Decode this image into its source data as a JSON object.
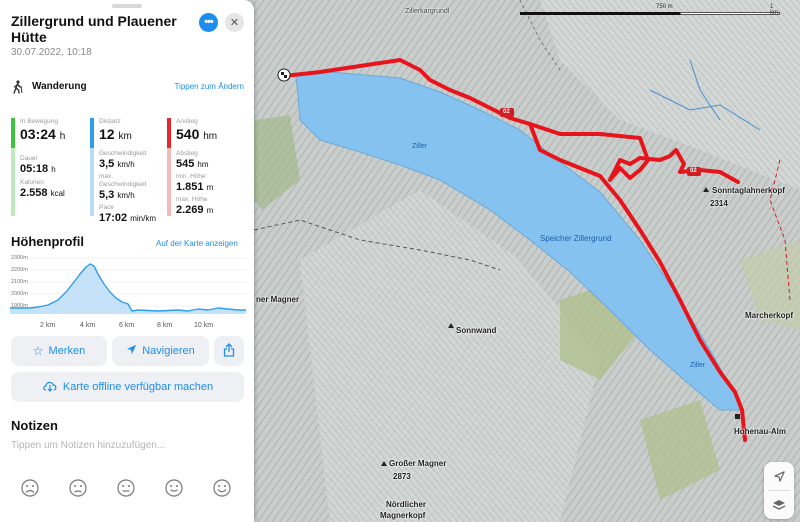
{
  "panel": {
    "title": "Zillergrund und Plauener Hütte",
    "date": "30.07.2022, 10:18",
    "more_icon": "ellipsis-icon",
    "close_icon": "close-icon",
    "activity": {
      "icon": "hiker-icon",
      "label": "Wanderung",
      "change_link": "Tippen zum Ändern"
    },
    "stats": [
      {
        "color_top": "#3cc43c",
        "color_bottom": "#bfe9bd",
        "items": [
          {
            "label": "In Bewegung",
            "value": "03:24",
            "unit": "h"
          },
          {
            "label": "Dauer",
            "value": "05:18",
            "unit": "h"
          },
          {
            "label": "Kalorien",
            "value": "2.558",
            "unit": "kcal"
          }
        ]
      },
      {
        "color_top": "#2f9ef0",
        "color_bottom": "#b9dcf8",
        "items": [
          {
            "label": "Distanz",
            "value": "12",
            "unit": "km"
          },
          {
            "label": "Geschwindigkeit",
            "value": "3,5",
            "unit": "km/h"
          },
          {
            "label": "max. Geschwindigkeit",
            "value": "5,3",
            "unit": "km/h"
          },
          {
            "label": "Pace",
            "value": "17:02",
            "unit": "min/km"
          }
        ]
      },
      {
        "color_top": "#e9262a",
        "color_bottom": "#f4b9b9",
        "items": [
          {
            "label": "Anstieg",
            "value": "540",
            "unit": "hm"
          },
          {
            "label": "Abstieg",
            "value": "545",
            "unit": "hm"
          },
          {
            "label": "min. Höhe",
            "value": "1.851",
            "unit": "m"
          },
          {
            "label": "max. Höhe",
            "value": "2.269",
            "unit": "m"
          }
        ]
      }
    ],
    "profile": {
      "title": "Höhenprofil",
      "map_link": "Auf der Karte anzeigen",
      "y_ticks": [
        "2300m",
        "2200m",
        "2100m",
        "2000m",
        "1900m"
      ],
      "x_ticks": [
        "2 km",
        "4 km",
        "6 km",
        "8 km",
        "10 km"
      ],
      "line_color": "#2f9ef0"
    },
    "buttons": {
      "bookmark": {
        "label": "Merken",
        "icon": "star-icon"
      },
      "navigate": {
        "label": "Navigieren",
        "icon": "navigation-arrow-icon"
      },
      "share": {
        "icon": "share-icon"
      },
      "offline": {
        "label": "Karte offline verfügbar machen",
        "icon": "cloud-download-icon"
      }
    },
    "notes": {
      "title": "Notizen",
      "placeholder": "Tippen um Notizen hinzuzufügen..."
    },
    "ratings": [
      "very-sad-face-icon",
      "sad-face-icon",
      "neutral-face-icon",
      "happy-face-icon",
      "very-happy-face-icon"
    ]
  },
  "map": {
    "labels": {
      "zillerkar": "Zillerkargrundl",
      "lake": "Speicher Zillergrund",
      "ziller1": "Ziller",
      "ziller2": "Ziller",
      "sonnwand": "Sonnwand",
      "grosser_magner": "Großer Magner",
      "grosser_magner_alt": "2873",
      "nordlicher": "Nördlicher",
      "magnerkopf": "Magnerkopf",
      "magner_left": "ner Magner",
      "sonntag": "Sonntaglahnerkopf",
      "sonntag_alt": "2314",
      "marcher": "Marcherkopf",
      "hohenau": "Hohenau-Alm",
      "route1": "02",
      "route2": "02"
    },
    "scale": {
      "label1": "750 m",
      "label2": "1 km"
    },
    "controls": {
      "locate_icon": "location-arrow-icon",
      "layers_icon": "layers-icon"
    },
    "route_color": "#e8141b",
    "water_color": "#86c2f0"
  }
}
